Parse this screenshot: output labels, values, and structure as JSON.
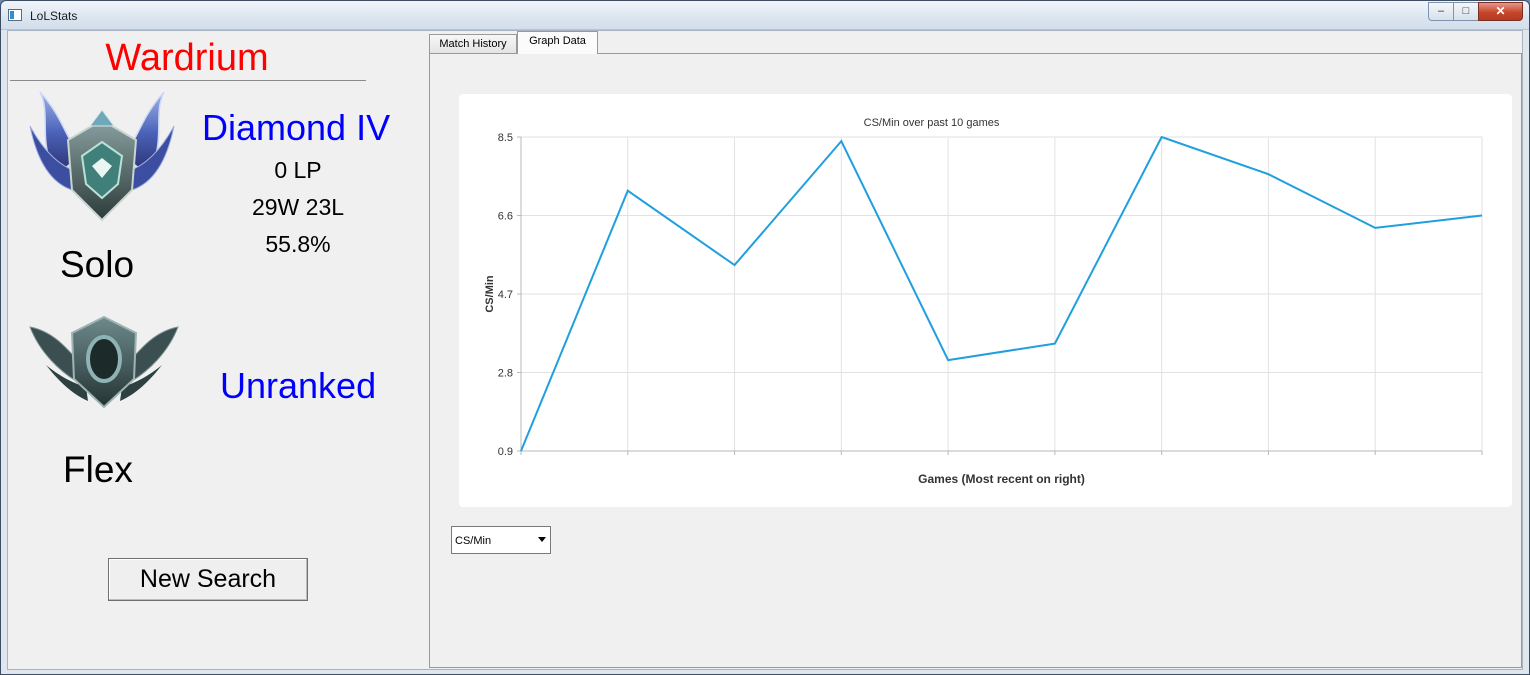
{
  "window": {
    "title": "LoLStats",
    "controls": {
      "minimize": "–",
      "maximize": "□",
      "close": "✕"
    }
  },
  "profile": {
    "summoner_name": "Wardrium",
    "solo": {
      "queue": "Solo",
      "rank": "Diamond IV",
      "lp": "0 LP",
      "record": "29W 23L",
      "winrate": "55.8%",
      "emblem": "diamond-emblem-icon"
    },
    "flex": {
      "queue": "Flex",
      "rank": "Unranked",
      "emblem": "unranked-emblem-icon"
    },
    "new_search_label": "New Search"
  },
  "tabs": [
    {
      "label": "Match History",
      "active": false
    },
    {
      "label": "Graph Data",
      "active": true
    }
  ],
  "metric_select": {
    "value": "CS/Min"
  },
  "colors": {
    "summoner_name": "#ff0000",
    "rank": "#0000ff",
    "series": "#209fdf"
  },
  "chart_data": {
    "type": "line",
    "title": "CS/Min over past 10 games",
    "xlabel": "Games (Most recent on right)",
    "ylabel": "CS/Min",
    "ylim": [
      0.9,
      8.5
    ],
    "yticks": [
      "8.5",
      "6.6",
      "4.7",
      "2.8",
      "0.9"
    ],
    "x": [
      1,
      2,
      3,
      4,
      5,
      6,
      7,
      8,
      9,
      10
    ],
    "series": [
      {
        "values": [
          0.9,
          7.2,
          5.4,
          8.4,
          3.1,
          3.5,
          8.5,
          7.6,
          6.3,
          6.6
        ]
      }
    ],
    "grid": true,
    "legend": "none"
  }
}
